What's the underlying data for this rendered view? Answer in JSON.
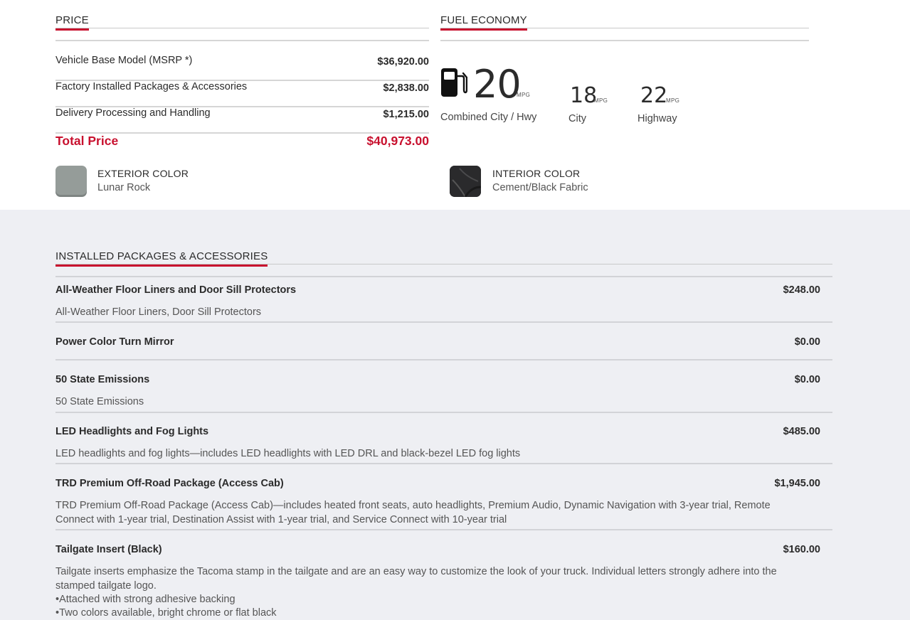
{
  "price": {
    "heading": "PRICE",
    "rows": [
      {
        "label": "Vehicle Base Model (MSRP *)",
        "value": "$36,920.00"
      },
      {
        "label": "Factory Installed Packages & Accessories",
        "value": "$2,838.00"
      },
      {
        "label": "Delivery Processing and Handling",
        "value": "$1,215.00"
      }
    ],
    "total": {
      "label": "Total Price",
      "value": "$40,973.00"
    }
  },
  "fuel": {
    "heading": "FUEL ECONOMY",
    "icon": "fuel-pump-icon",
    "combined": {
      "value": "20",
      "unit": "MPG",
      "label": "Combined City / Hwy"
    },
    "city": {
      "value": "18",
      "unit": "MPG",
      "label": "City"
    },
    "highway": {
      "value": "22",
      "unit": "MPG",
      "label": "Highway"
    }
  },
  "colors": {
    "exterior": {
      "title": "EXTERIOR COLOR",
      "value": "Lunar Rock",
      "swatch": "#959c99"
    },
    "interior": {
      "title": "INTERIOR COLOR",
      "value": "Cement/Black Fabric",
      "swatch": "#2a2a2c"
    }
  },
  "packages": {
    "heading": "INSTALLED PACKAGES & ACCESSORIES",
    "items": [
      {
        "name": "All-Weather Floor Liners and Door Sill Protectors",
        "price": "$248.00",
        "desc": "All-Weather Floor Liners, Door Sill Protectors"
      },
      {
        "name": "Power Color Turn Mirror",
        "price": "$0.00",
        "desc": ""
      },
      {
        "name": "50 State Emissions",
        "price": "$0.00",
        "desc": "50 State Emissions"
      },
      {
        "name": "LED Headlights and Fog Lights",
        "price": "$485.00",
        "desc": "LED headlights and fog lights—includes LED headlights with LED DRL and black-bezel LED fog lights"
      },
      {
        "name": "TRD Premium Off-Road Package (Access Cab)",
        "price": "$1,945.00",
        "desc": "TRD Premium Off-Road Package (Access Cab)—includes heated front seats, auto headlights, Premium Audio, Dynamic Navigation with 3-year trial, Remote Connect with 1-year trial, Destination Assist with 1-year trial, and Service Connect with 10-year trial"
      },
      {
        "name": "Tailgate Insert (Black)",
        "price": "$160.00",
        "desc": "Tailgate inserts emphasize the Tacoma stamp in the tailgate and are an easy way to customize the look of your truck. Individual letters strongly adhere into the stamped tailgate logo.",
        "bullets": [
          "•Attached with strong adhesive backing",
          "•Two colors available, bright chrome or flat black"
        ]
      }
    ]
  },
  "accent_color": "#c8102e"
}
